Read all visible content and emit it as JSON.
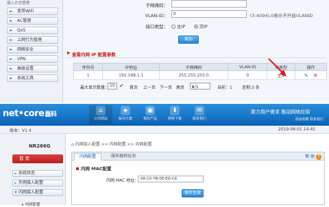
{
  "top": {
    "sidebar": {
      "current": "接入方式管理",
      "items": [
        "宽带WiFi",
        "AC管理",
        "QoS",
        "上网行为管理",
        "网络安全",
        "VPN",
        "高级设置",
        "系统工具"
      ]
    },
    "form": {
      "subnet_label": "子网掩码：",
      "vlan_label": "VLAN-ID：",
      "vlan_value": "0",
      "vlan_hint": "(3-4094),0表示不开启VLANID",
      "iface_label": "接口类型：",
      "iface_options": [
        "主IP",
        "次IP"
      ],
      "iface_selected": "次IP",
      "add_button": "增加"
    },
    "section_title": "查看内网 IP 配置参数",
    "table": {
      "headers": [
        "序列号",
        "IP地址",
        "子网掩码",
        "VLAN-ID",
        "IP类型",
        "操作"
      ],
      "rows": [
        [
          "1",
          "192.168.1.1",
          "255.255.255.0",
          "0",
          "主IP"
        ]
      ]
    },
    "pager": {
      "page_size_label": "最大显示数量：",
      "page_size_value": "10",
      "first": "首页",
      "prev": "上一页",
      "next": "下一页",
      "last": "尾页",
      "page_select": "1/1",
      "current_page": "当前：1",
      "total": "还剩:3 条"
    }
  },
  "bottom": {
    "header": {
      "logo": "net•core",
      "logo_cn": "磊科",
      "nav": [
        "公司网站",
        "解决方案",
        "相关产品",
        "网络下载",
        "联系我们"
      ],
      "slogan": "致力用户需求   推动网络应用",
      "links": "添加收藏  联系我们"
    },
    "version": "版本：V1.4",
    "datetime": "2019-08-01 14:45",
    "model": "NR266G",
    "home_button": "首  页",
    "sidebar_items": [
      "系统状态",
      "外网接入配置",
      "内网接入配置"
    ],
    "sidebar_sub": "内网配置",
    "breadcrumb": "内网接入配置 >> 内网配置 >> 内网配置",
    "tabs": [
      "内网配置",
      "服务器地址池"
    ],
    "help": "帮 助",
    "section_title": "内网 MAC配置",
    "mac_label": "内网 MAC 地址：",
    "mac_value": "08-10-7B-0E-ED-C6",
    "save_button": "保存生效"
  }
}
